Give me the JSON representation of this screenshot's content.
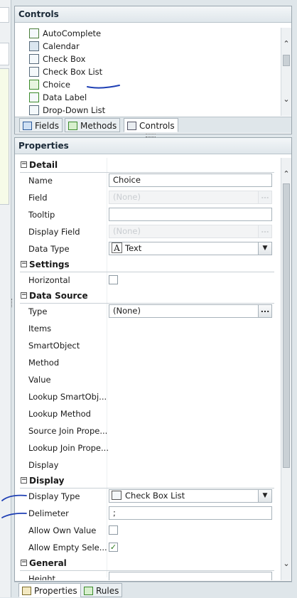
{
  "controls_panel": {
    "title": "Controls",
    "items": [
      {
        "label": "AutoComplete",
        "icon": "autocomplete-icon"
      },
      {
        "label": "Calendar",
        "icon": "calendar-icon"
      },
      {
        "label": "Check Box",
        "icon": "checkbox-icon"
      },
      {
        "label": "Check Box List",
        "icon": "checkbox-list-icon"
      },
      {
        "label": "Choice",
        "icon": "choice-icon"
      },
      {
        "label": "Data Label",
        "icon": "data-label-icon"
      },
      {
        "label": "Drop-Down List",
        "icon": "dropdown-list-icon"
      }
    ],
    "tabs": [
      {
        "label": "Fields",
        "icon": "fields-icon"
      },
      {
        "label": "Methods",
        "icon": "methods-icon"
      },
      {
        "label": "Controls",
        "icon": "controls-icon"
      }
    ],
    "active_tab": "Controls"
  },
  "properties_panel": {
    "title": "Properties",
    "sections": {
      "detail": "Detail",
      "settings": "Settings",
      "data_source": "Data Source",
      "display": "Display",
      "general": "General"
    },
    "rows": {
      "name": {
        "label": "Name",
        "value": "Choice"
      },
      "field": {
        "label": "Field",
        "value": "(None)"
      },
      "tooltip": {
        "label": "Tooltip",
        "value": ""
      },
      "display_field": {
        "label": "Display Field",
        "value": "(None)"
      },
      "data_type": {
        "label": "Data Type",
        "value": "Text",
        "glyph": "A"
      },
      "horizontal": {
        "label": "Horizontal",
        "checked": false
      },
      "type": {
        "label": "Type",
        "value": "(None)",
        "button": "..."
      },
      "items": {
        "label": "Items"
      },
      "smartobject": {
        "label": "SmartObject"
      },
      "method": {
        "label": "Method"
      },
      "value": {
        "label": "Value"
      },
      "lookup_smartobject": {
        "label": "Lookup SmartObj..."
      },
      "lookup_method": {
        "label": "Lookup Method"
      },
      "source_join": {
        "label": "Source Join Prope..."
      },
      "lookup_join": {
        "label": "Lookup Join Prope..."
      },
      "display_row": {
        "label": "Display"
      },
      "display_type": {
        "label": "Display Type",
        "value": "Check Box List"
      },
      "delimeter": {
        "label": "Delimeter",
        "value": ";"
      },
      "allow_own_value": {
        "label": "Allow Own Value",
        "checked": false
      },
      "allow_empty": {
        "label": "Allow Empty Sele...",
        "checked": true,
        "mark": "✓"
      },
      "height": {
        "label": "Height"
      }
    },
    "tabs": [
      {
        "label": "Properties",
        "icon": "properties-icon"
      },
      {
        "label": "Rules",
        "icon": "rules-icon"
      }
    ],
    "active_tab": "Properties"
  },
  "colors": {
    "annotation_ink": "#1e3fb4",
    "panel_border": "#9aa6ae",
    "header_bg": "#e4eaee"
  }
}
